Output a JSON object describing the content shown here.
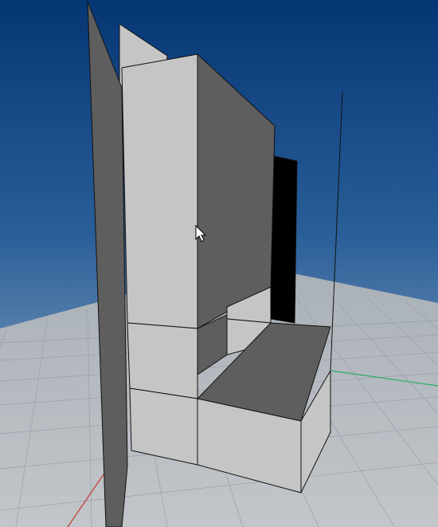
{
  "viewport": {
    "background": {
      "sky_top": "#053674",
      "sky_bottom": "#aebdcc",
      "ground": "#b8bdc2"
    },
    "grid": {
      "visible": true,
      "line_color": "#9aa0a6"
    },
    "axes": {
      "x_axis_color": "#c0392b",
      "y_axis_color": "#27ae60"
    },
    "model": {
      "face_colors": {
        "light": "#c5c5c5",
        "mid": "#5e5e5e",
        "dark": "#000000",
        "edge": "#111111"
      },
      "selected": "none"
    },
    "cursor": {
      "icon": "arrow-cursor-icon"
    }
  }
}
